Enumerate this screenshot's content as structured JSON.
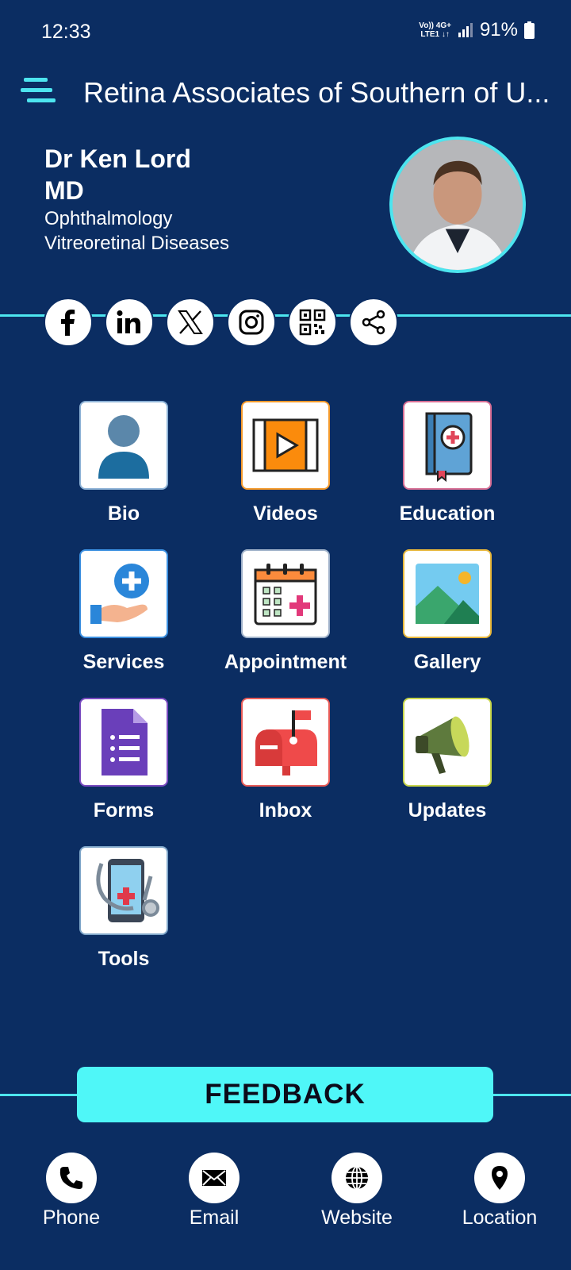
{
  "status_bar": {
    "time": "12:33",
    "net_line1": "Vo)) 4G+",
    "net_line2": "LTE1 ↓↑",
    "battery": "91%"
  },
  "app_bar": {
    "title": "Retina Associates of Southern of U...",
    "menu_icon": "hamburger-menu-icon"
  },
  "profile": {
    "name": "Dr Ken Lord",
    "degree": "MD",
    "specialty_1": "Ophthalmology",
    "specialty_2": "Vitreoretinal Diseases"
  },
  "social": [
    {
      "name": "facebook-icon"
    },
    {
      "name": "linkedin-icon"
    },
    {
      "name": "x-twitter-icon"
    },
    {
      "name": "instagram-icon"
    },
    {
      "name": "qr-code-icon"
    },
    {
      "name": "share-icon"
    }
  ],
  "tiles": {
    "bio": "Bio",
    "videos": "Videos",
    "education": "Education",
    "services": "Services",
    "appointment": "Appointment",
    "gallery": "Gallery",
    "forms": "Forms",
    "inbox": "Inbox",
    "updates": "Updates",
    "tools": "Tools"
  },
  "feedback": "FEEDBACK",
  "bottom_nav": {
    "phone": "Phone",
    "email": "Email",
    "website": "Website",
    "location": "Location"
  },
  "colors": {
    "background": "#0b2d62",
    "accent": "#4de5ef",
    "feedback_bg": "#4ff7f8"
  }
}
